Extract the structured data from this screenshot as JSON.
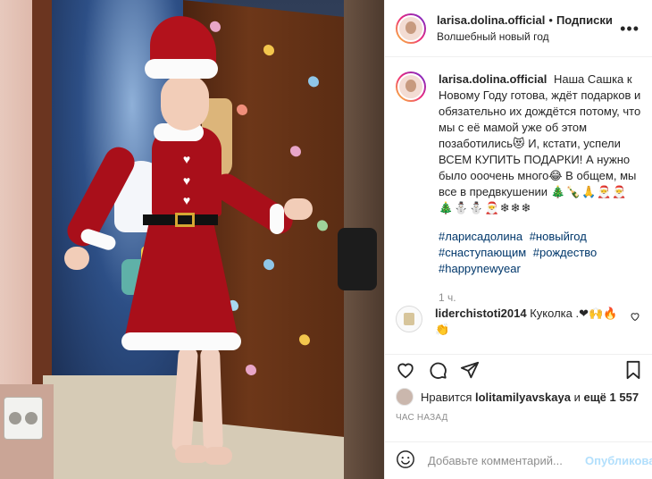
{
  "header": {
    "username": "larisa.dolina.official",
    "separator": "•",
    "follow_label": "Подписки",
    "location": "Волшебный новый год",
    "more_icon": "more-horizontal-icon"
  },
  "caption": {
    "username": "larisa.dolina.official",
    "text": "Наша Сашка к Новому Году готова, ждёт подарков и обязательно их дождётся потому, что мы с её мамой уже об этом позаботились😻 И, кстати, успели ВСЕМ КУПИТЬ ПОДАРКИ! А нужно было ооочень много😂 В общем, мы все в предвкушении",
    "emoji_line": "🎄🍾🙏🎅🎅🎄⛄⛄🎅❄❄❄",
    "hashtags": [
      "#ларисадолина",
      "#новыйгод",
      "#снаступающим",
      "#рождество",
      "#happynewyear"
    ],
    "time_ago": "1 ч."
  },
  "comment": {
    "username": "liderchistoti2014",
    "text": "Куколка .❤🙌🔥",
    "emoji_tail": "👏"
  },
  "likes": {
    "prefix": "Нравится",
    "user": "lolitamilyavskaya",
    "conjunction": "и",
    "others": "ещё 1 557"
  },
  "posted_label": "ЧАС НАЗАД",
  "add_comment": {
    "placeholder": "Добавьте комментарий...",
    "publish_label": "Опубликовать"
  },
  "colors": {
    "link": "#00376b",
    "muted": "#8e8e8e",
    "publish_disabled": "#b2dffc",
    "text": "#262626"
  }
}
